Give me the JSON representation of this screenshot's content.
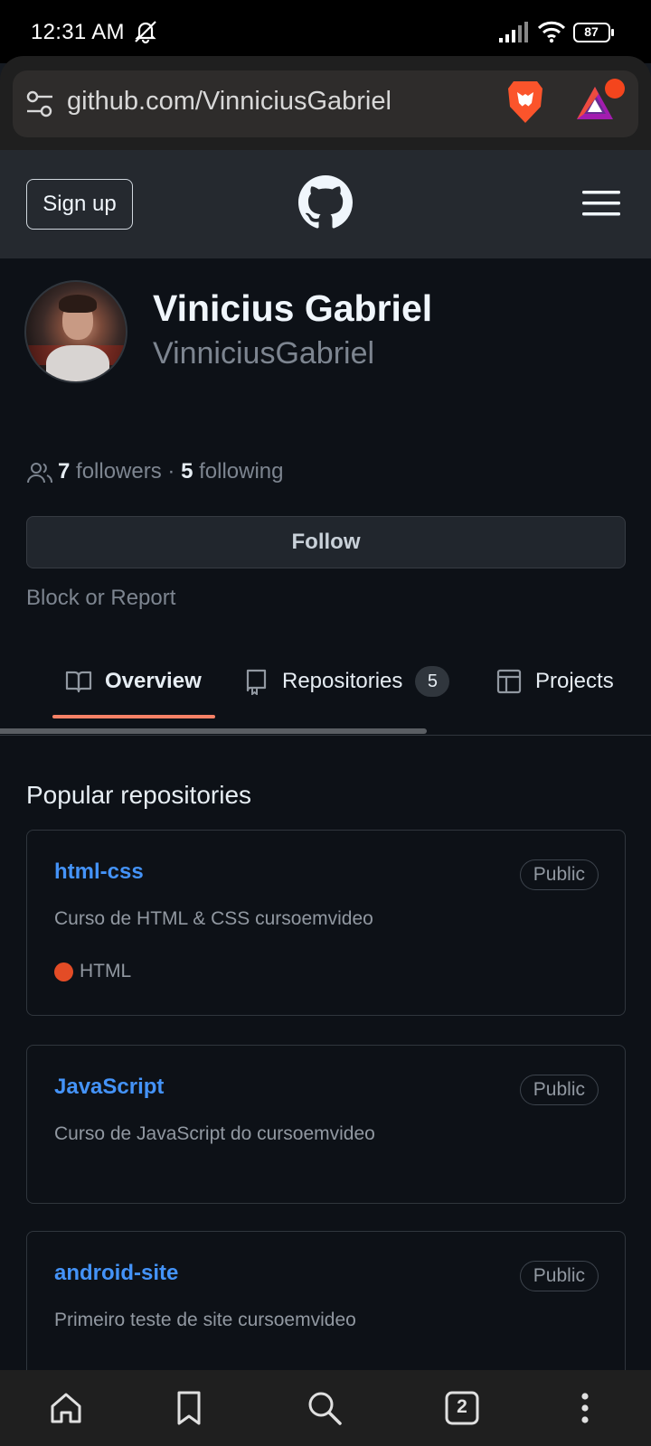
{
  "status_bar": {
    "time": "12:31 AM",
    "battery": "87",
    "icons": [
      "mute-icon",
      "signal-icon",
      "wifi-icon",
      "battery-icon"
    ]
  },
  "browser": {
    "url": "github.com/VinniciusGabriel",
    "icons": [
      "site-settings-icon",
      "brave-shield-icon",
      "brave-rewards-icon"
    ]
  },
  "header": {
    "signup_label": "Sign up",
    "logo": "github-logo-icon",
    "menu": "hamburger-menu-icon"
  },
  "profile": {
    "name": "Vinicius Gabriel",
    "username": "VinniciusGabriel",
    "followers_count": "7",
    "followers_label": "followers",
    "separator": "·",
    "following_count": "5",
    "following_label": "following",
    "follow_label": "Follow",
    "block_label": "Block or Report"
  },
  "tabs": [
    {
      "label": "Overview",
      "icon": "book-icon",
      "selected": true
    },
    {
      "label": "Repositories",
      "icon": "repo-icon",
      "count": "5"
    },
    {
      "label": "Projects",
      "icon": "table-icon"
    }
  ],
  "popular": {
    "title": "Popular repositories",
    "repos": [
      {
        "name": "html-css",
        "visibility": "Public",
        "description": "Curso de HTML & CSS cursoemvideo",
        "language": "HTML",
        "language_color": "#e34c26"
      },
      {
        "name": "JavaScript",
        "visibility": "Public",
        "description": "Curso de JavaScript do cursoemvideo"
      },
      {
        "name": "android-site",
        "visibility": "Public",
        "description": "Primeiro teste de site cursoemvideo"
      }
    ]
  },
  "bottom_nav": {
    "tab_count": "2",
    "icons": [
      "home-icon",
      "bookmark-icon",
      "search-icon",
      "tabs-icon",
      "more-icon"
    ]
  },
  "colors": {
    "accent_link": "#4493f8",
    "tab_underline": "#f78166",
    "background": "#0d1117"
  }
}
